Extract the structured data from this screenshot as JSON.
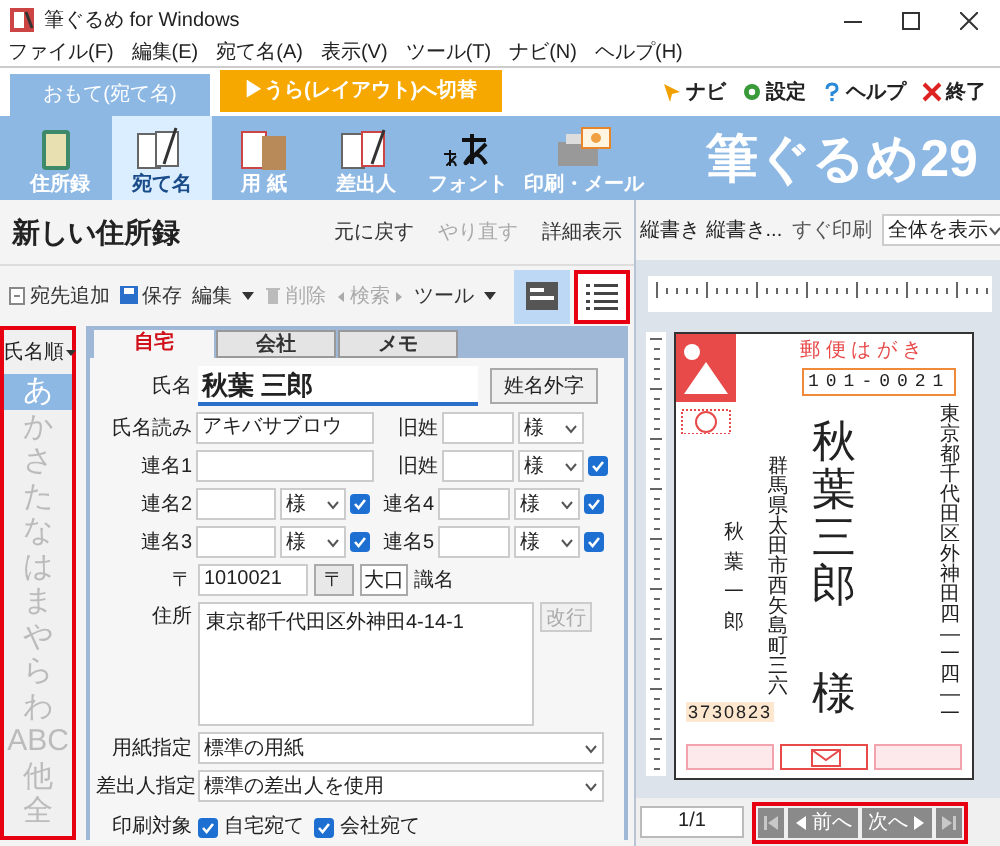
{
  "window": {
    "title": "筆ぐるめ for Windows"
  },
  "menu": [
    "ファイル(F)",
    "編集(E)",
    "宛て名(A)",
    "表示(V)",
    "ツール(T)",
    "ナビ(N)",
    "ヘルプ(H)"
  ],
  "mode_tabs": [
    {
      "label": "おもて(宛て名)",
      "selected": true
    },
    {
      "label": "▶うら(レイアウト)へ切替",
      "selected": false
    }
  ],
  "top_links": [
    {
      "kind": "navi",
      "label": "ナビ"
    },
    {
      "kind": "settings",
      "label": "設定"
    },
    {
      "kind": "help",
      "label": "ヘルプ"
    },
    {
      "kind": "exit",
      "label": "終了"
    }
  ],
  "toolbar": [
    {
      "kind": "book",
      "label": "住所録",
      "selected": false
    },
    {
      "kind": "address",
      "label": "宛て名",
      "selected": true
    },
    {
      "kind": "paper",
      "label": "用 紙",
      "selected": false
    },
    {
      "kind": "sender",
      "label": "差出人",
      "selected": false
    },
    {
      "kind": "font",
      "label": "フォント",
      "selected": false
    },
    {
      "kind": "print",
      "label": "印刷・メール",
      "selected": false
    }
  ],
  "logo": "筆ぐるめ29",
  "address_book": {
    "title": "新しい住所録",
    "actions": [
      {
        "label": "元に戻す",
        "disabled": false
      },
      {
        "label": "やり直す",
        "disabled": true
      },
      {
        "label": "詳細表示",
        "disabled": false
      }
    ]
  },
  "list_toolbar": [
    {
      "kind": "add",
      "label": "宛先追加",
      "disabled": false
    },
    {
      "kind": "save",
      "label": "保存",
      "disabled": false
    },
    {
      "kind": "menu",
      "label": "編集",
      "disabled": false
    },
    {
      "kind": "delete",
      "label": "削除",
      "disabled": true
    },
    {
      "kind": "search",
      "label": "検索",
      "disabled": true
    },
    {
      "kind": "menu",
      "label": "ツール",
      "disabled": false
    }
  ],
  "view_buttons": [
    {
      "kind": "card",
      "selected": true,
      "highlighted": false
    },
    {
      "kind": "list",
      "selected": false,
      "highlighted": true
    }
  ],
  "index": {
    "sort": "氏名順",
    "highlighted": true,
    "items": [
      {
        "label": "あ",
        "selected": true
      },
      {
        "label": "か",
        "selected": false
      },
      {
        "label": "さ",
        "selected": false
      },
      {
        "label": "た",
        "selected": false
      },
      {
        "label": "な",
        "selected": false
      },
      {
        "label": "は",
        "selected": false
      },
      {
        "label": "ま",
        "selected": false
      },
      {
        "label": "や",
        "selected": false
      },
      {
        "label": "ら",
        "selected": false
      },
      {
        "label": "わ",
        "selected": false
      },
      {
        "label": "ABC",
        "selected": false
      },
      {
        "label": "他",
        "selected": false
      },
      {
        "label": "全",
        "selected": false
      }
    ]
  },
  "form": {
    "tabs": [
      {
        "label": "自宅",
        "selected": true
      },
      {
        "label": "会社",
        "selected": false
      },
      {
        "label": "メモ",
        "selected": false
      }
    ],
    "name": {
      "label": "氏名",
      "value": "秋葉 三郎",
      "button": "姓名外字"
    },
    "rows": [
      {
        "left": {
          "label": "氏名読み",
          "value": "アキバサブロウ"
        },
        "right": {
          "label": "旧姓",
          "honorific": "様"
        }
      },
      {
        "left": {
          "label": "連名1"
        },
        "right": {
          "label": "旧姓",
          "honorific": "様",
          "checked": true
        }
      },
      {
        "left": {
          "label": "連名2",
          "honorific": "様",
          "checked": true
        },
        "right": {
          "label": "連名4",
          "honorific": "様",
          "checked": true
        }
      },
      {
        "left": {
          "label": "連名3",
          "honorific": "様",
          "checked": true
        },
        "right": {
          "label": "連名5",
          "honorific": "様",
          "checked": true
        }
      }
    ],
    "postal": {
      "mark": "〒",
      "value": "1010021",
      "button": "〒",
      "large_button": "大口",
      "label": "識名"
    },
    "address": {
      "label": "住所",
      "value": "東京都千代田区外神田4-14-1",
      "button": "改行",
      "button_disabled": true
    },
    "paper": {
      "label": "用紙指定",
      "value": "標準の用紙"
    },
    "sender": {
      "label": "差出人指定",
      "value": "標準の差出人を使用"
    },
    "print_target": {
      "label": "印刷対象",
      "options": [
        {
          "label": "自宅宛て",
          "checked": true
        },
        {
          "label": "会社宛て",
          "checked": true
        }
      ]
    }
  },
  "preview": {
    "layout": "縦書き 縦書き...",
    "print": "すぐ印刷",
    "zoom": "全体を表示",
    "card": {
      "caption": "郵 便 は が き",
      "postal_code": "101-0021",
      "address": "東京都千代田区外神田四―一四―一",
      "name": "秋葉三郎",
      "honorific": "様",
      "sender_address": "群馬県太田市西矢島町三六",
      "sender_name": "秋葉一郎",
      "sender_postal": "3730823"
    },
    "page": "1/1",
    "nav_highlighted": true,
    "nav": [
      {
        "kind": "first",
        "disabled": true
      },
      {
        "kind": "prev",
        "label": "前へ",
        "disabled": false
      },
      {
        "kind": "next",
        "label": "次へ",
        "disabled": false
      },
      {
        "kind": "last",
        "disabled": true
      }
    ]
  }
}
